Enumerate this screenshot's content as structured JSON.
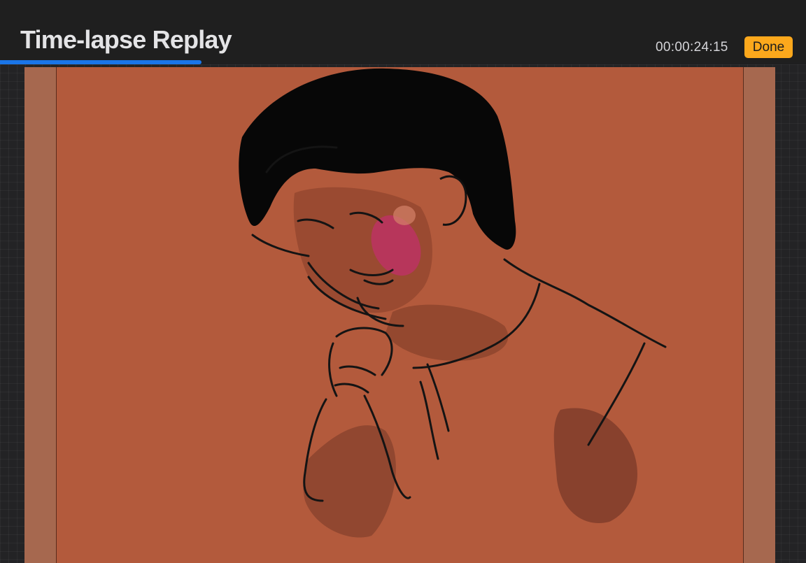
{
  "header": {
    "title": "Time-lapse Replay",
    "timecode": "00:00:24:15",
    "done_label": "Done"
  },
  "playback": {
    "progress_fraction": 0.25
  },
  "colors": {
    "accent_orange": "#fca81c",
    "progress_blue": "#1a75e8",
    "canvas": "#b35a3c",
    "canvas_margin": "#a6684f"
  },
  "artwork": {
    "subject": "sketch of a person looking down with hand on chin"
  }
}
